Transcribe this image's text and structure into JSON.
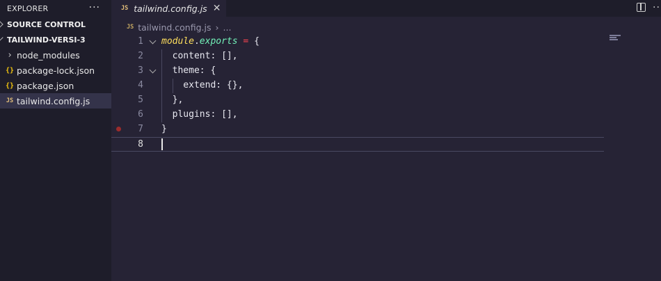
{
  "explorer": {
    "title": "EXPLORER",
    "more": "···",
    "source_control": "SOURCE CONTROL",
    "project": "TAILWIND-VERSI-3",
    "items": [
      {
        "icon": "folder",
        "glyph": "›",
        "label": "node_modules"
      },
      {
        "icon": "json",
        "glyph": "{}",
        "label": "package-lock.json"
      },
      {
        "icon": "json",
        "glyph": "{}",
        "label": "package.json"
      },
      {
        "icon": "js",
        "glyph": "JS",
        "label": "tailwind.config.js"
      }
    ]
  },
  "tab": {
    "badge": "JS",
    "label": "tailwind.config.js",
    "close": "✕"
  },
  "tabbar_more": "···",
  "breadcrumb": {
    "badge": "JS",
    "file": "tailwind.config.js",
    "sep": "›",
    "rest": "..."
  },
  "editor": {
    "line_numbers": [
      "1",
      "2",
      "3",
      "4",
      "5",
      "6",
      "7",
      "8"
    ],
    "lines": {
      "l1_a": "module",
      "l1_b": ".",
      "l1_c": "exports",
      "l1_d": " = ",
      "l1_e": "{",
      "l2": "  content: [],",
      "l3": "  theme: {",
      "l4": "    extend: {},",
      "l5": "  },",
      "l6": "  plugins: [],",
      "l7": "}"
    }
  },
  "colors": {
    "bg": "#262335",
    "sidebar": "#1e1d2a",
    "breakpoint": "#9b2c2c"
  }
}
